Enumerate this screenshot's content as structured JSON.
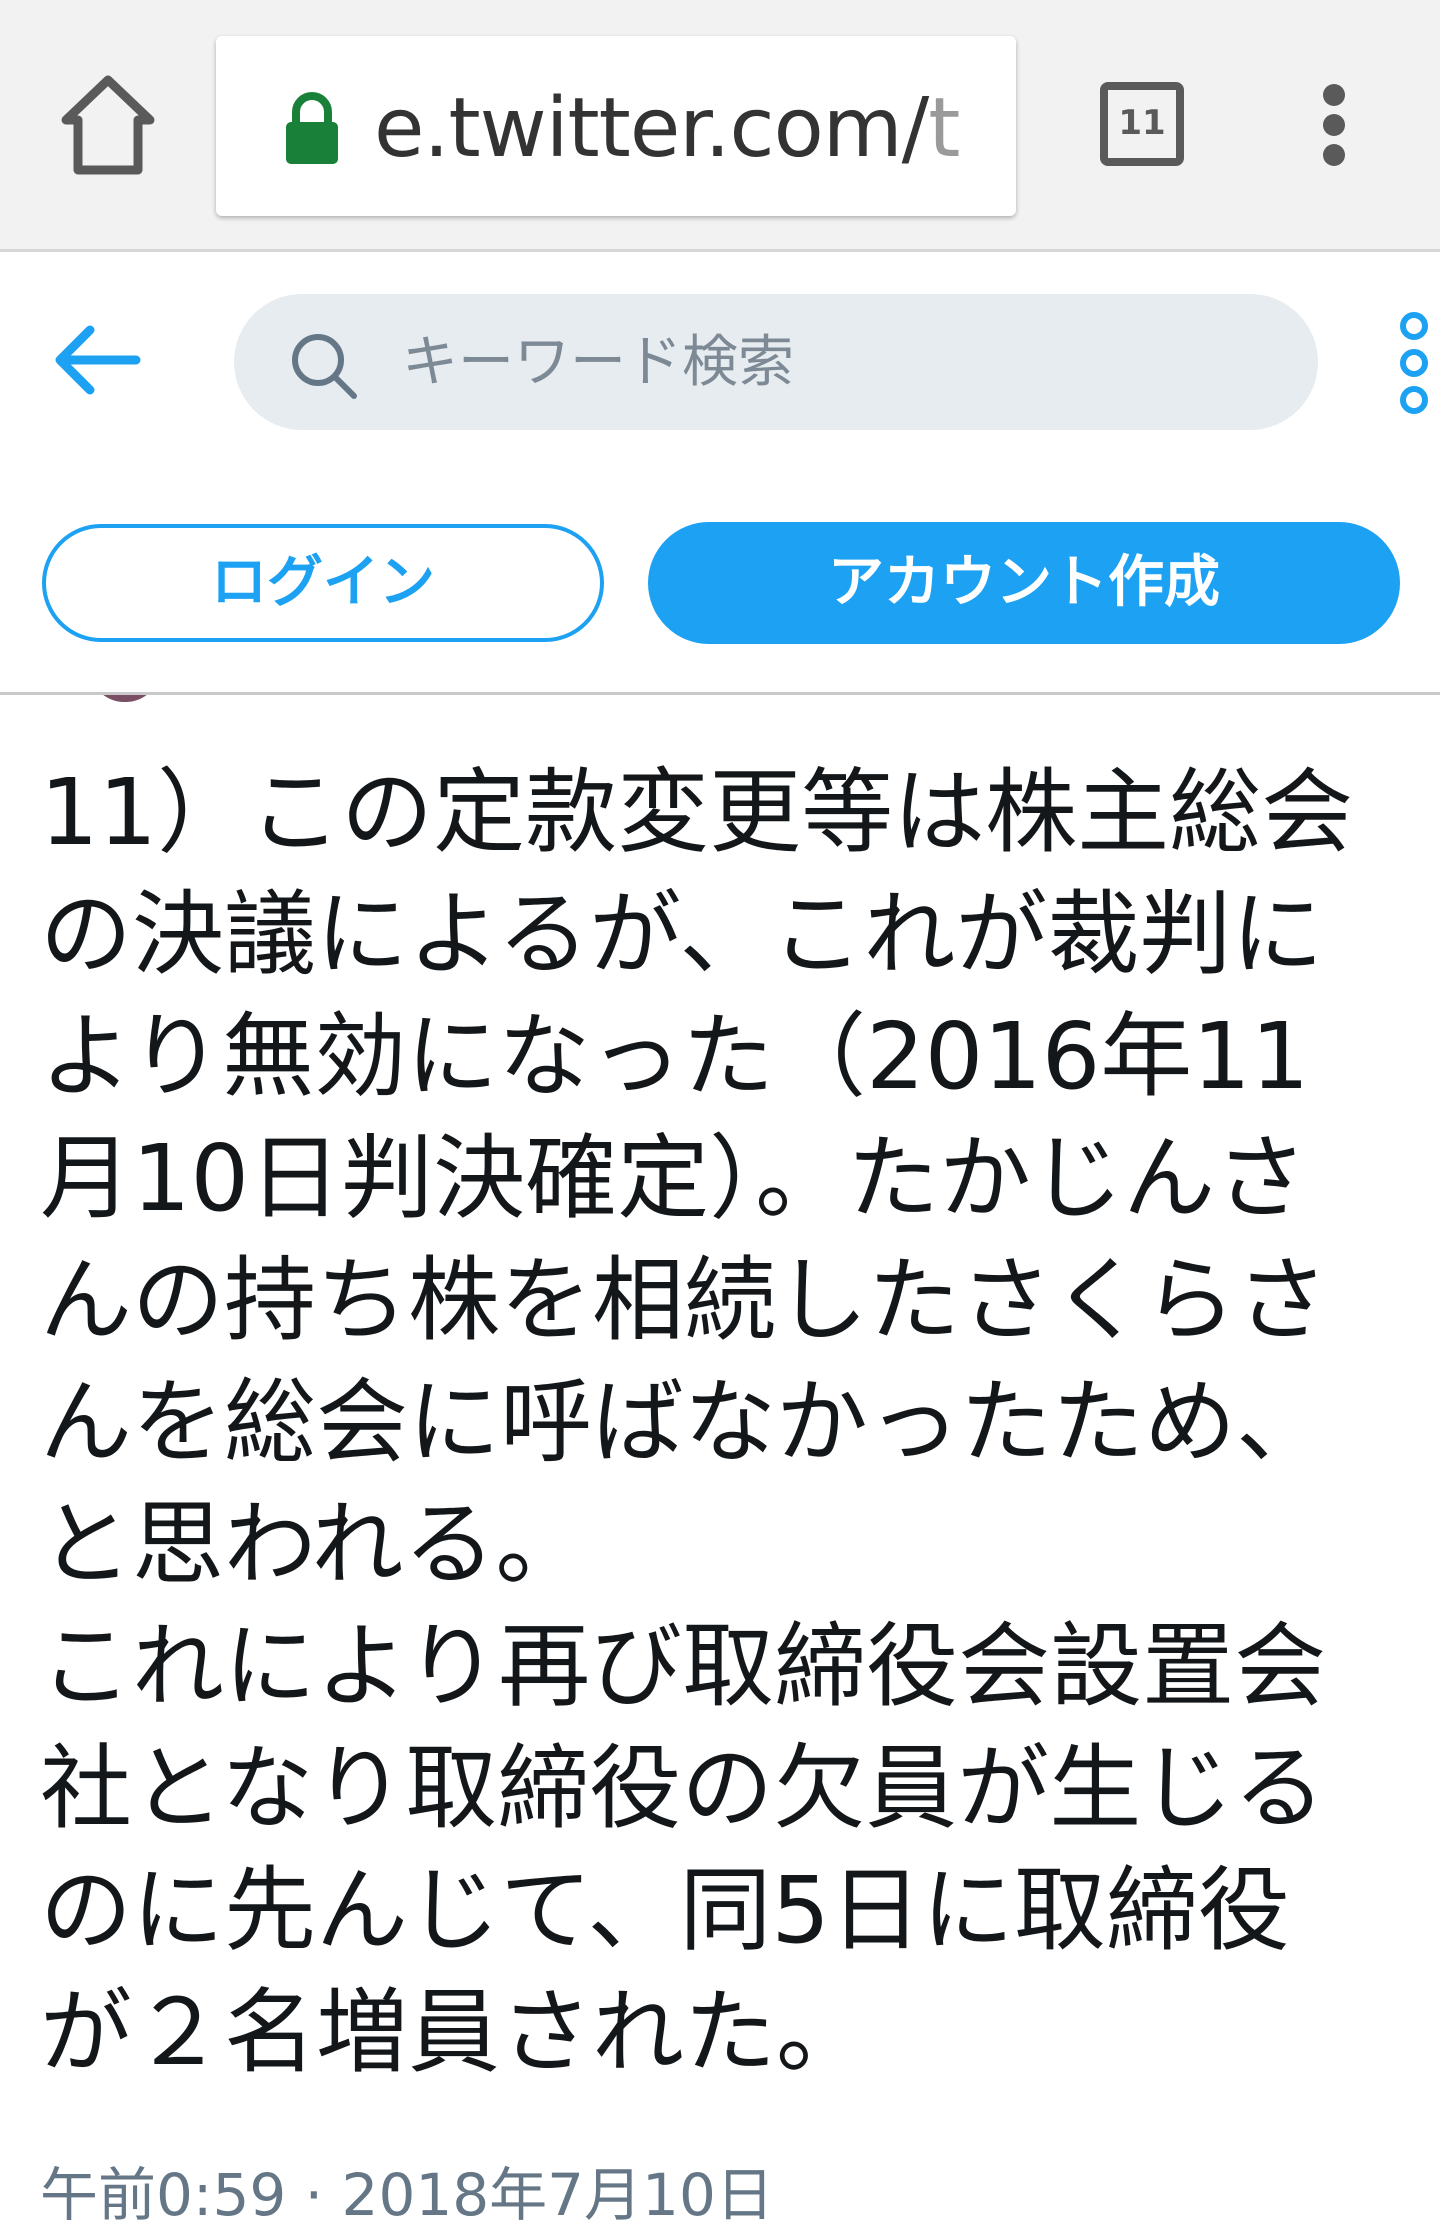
{
  "browser": {
    "url_main": "e.twitter.com/",
    "url_tail": "t",
    "tab_count": "11",
    "icons": {
      "home": "home-icon",
      "lock": "lock-icon",
      "tabs": "tab-switcher-icon",
      "menu": "overflow-menu-icon"
    }
  },
  "header": {
    "search_placeholder": "キーワード検索",
    "login_label": "ログイン",
    "signup_label": "アカウント作成",
    "icons": {
      "back": "arrow-left-icon",
      "search": "search-icon",
      "more": "more-vertical-icon"
    },
    "accent_color": "#1da1f2"
  },
  "tweet": {
    "lines": [
      "11）この定款変更等は株主総会",
      "の決議によるが、これが裁判に",
      "より無効になった（2016年11",
      "月10日判決確定）。たかじんさ",
      "んの持ち株を相続したさくらさ",
      "んを総会に呼ばなかったため、",
      "と思われる。",
      "これにより再び取締役会設置会",
      "社となり取締役の欠員が生じる",
      "のに先んじて、同5日に取締役",
      "が２名増員された。"
    ],
    "timestamp": "午前0:59 · 2018年7月10日"
  }
}
